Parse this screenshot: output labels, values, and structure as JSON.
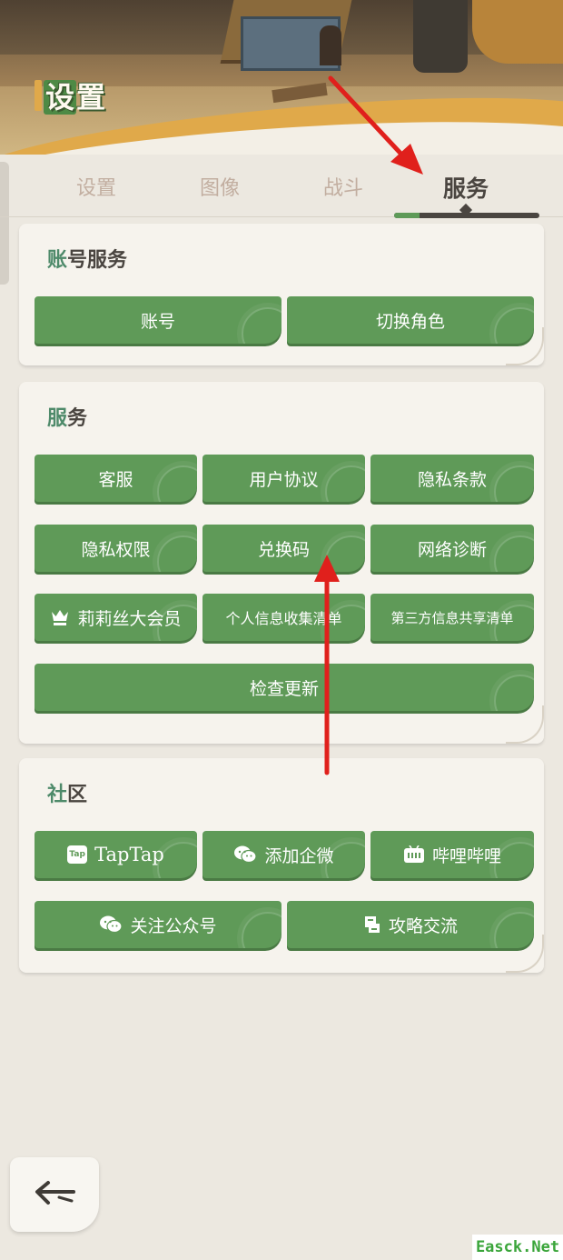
{
  "header": {
    "logo_text_first": "设",
    "logo_text_rest": "置"
  },
  "tabs": [
    {
      "label": "设置",
      "active": false
    },
    {
      "label": "图像",
      "active": false
    },
    {
      "label": "战斗",
      "active": false
    },
    {
      "label": "服务",
      "active": true
    }
  ],
  "account_section": {
    "title_accent": "账",
    "title_rest": "号服务",
    "buttons": [
      {
        "label": "账号"
      },
      {
        "label": "切换角色"
      }
    ]
  },
  "service_section": {
    "title_accent": "服",
    "title_rest": "务",
    "buttons": [
      {
        "label": "客服"
      },
      {
        "label": "用户协议"
      },
      {
        "label": "隐私条款"
      },
      {
        "label": "隐私权限"
      },
      {
        "label": "兑换码"
      },
      {
        "label": "网络诊断"
      },
      {
        "label": "莉莉丝大会员",
        "icon": "crown-icon"
      },
      {
        "label": "个人信息收集清单"
      },
      {
        "label": "第三方信息共享清单"
      },
      {
        "label": "检查更新"
      }
    ]
  },
  "community_section": {
    "title_accent": "社",
    "title_rest": "区",
    "buttons": [
      {
        "label": "TapTap",
        "icon": "taptap-icon",
        "icon_text": "Tap"
      },
      {
        "label": "添加企微",
        "icon": "wechat-icon"
      },
      {
        "label": "哔哩哔哩",
        "icon": "bilibili-icon"
      },
      {
        "label": "关注公众号",
        "icon": "wechat-icon"
      },
      {
        "label": "攻略交流",
        "icon": "guide-icon"
      }
    ]
  },
  "footer": {
    "back_icon": "back-arrow-icon",
    "watermark": "Easck.Net"
  },
  "colors": {
    "button_green": "#5f9a58",
    "accent_teal": "#4e8a6a",
    "annotation_red": "#e0201c"
  }
}
